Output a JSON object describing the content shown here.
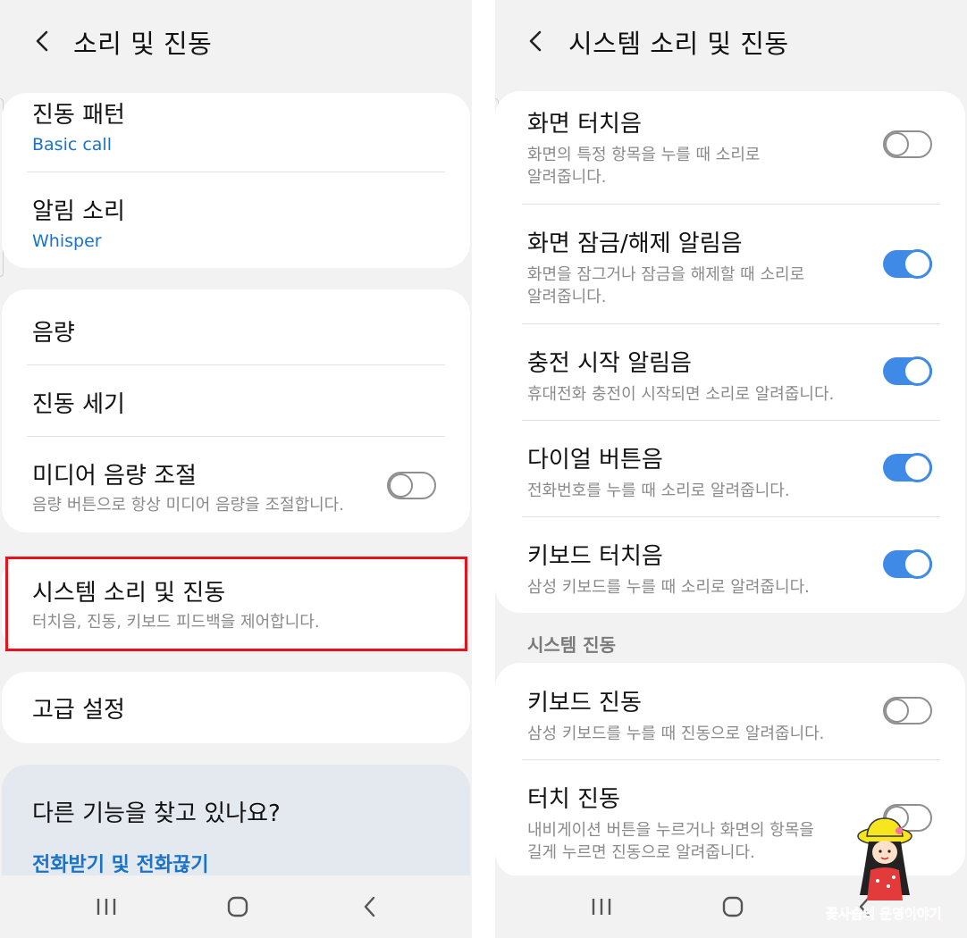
{
  "left": {
    "header": {
      "title": "소리 및 진동"
    },
    "card1": [
      {
        "title": "진동 패턴",
        "value": "Basic call"
      },
      {
        "title": "알림 소리",
        "value": "Whisper"
      }
    ],
    "card2": {
      "volume": "음량",
      "vibration_intensity": "진동 세기",
      "media_volume": {
        "title": "미디어 음량 조절",
        "subtitle": "음량 버튼으로 항상 미디어 음량을 조절합니다.",
        "enabled": false
      }
    },
    "system_sound": {
      "title": "시스템 소리 및 진동",
      "subtitle": "터치음, 진동, 키보드 피드백을 제어합니다."
    },
    "advanced": {
      "title": "고급 설정"
    },
    "search": {
      "question": "다른 기능을 찾고 있나요?",
      "link": "전화받기 및 전화끊기"
    }
  },
  "right": {
    "header": {
      "title": "시스템 소리 및 진동"
    },
    "sound_items": [
      {
        "title": "화면 터치음",
        "subtitle": "화면의 특정 항목을 누를 때 소리로\n알려줍니다.",
        "enabled": false
      },
      {
        "title": "화면 잠금/해제 알림음",
        "subtitle": "화면을 잠그거나 잠금을 해제할 때 소리로\n알려줍니다.",
        "enabled": true
      },
      {
        "title": "충전 시작 알림음",
        "subtitle": "휴대전화 충전이 시작되면 소리로 알려줍니다.",
        "enabled": true
      },
      {
        "title": "다이얼 버튼음",
        "subtitle": "전화번호를 누를 때 소리로 알려줍니다.",
        "enabled": true
      },
      {
        "title": "키보드 터치음",
        "subtitle": "삼성 키보드를 누를 때 소리로 알려줍니다.",
        "enabled": true
      }
    ],
    "section_label": "시스템 진동",
    "vibration_items": [
      {
        "title": "키보드 진동",
        "subtitle": "삼성 키보드를 누를 때 진동으로 알려줍니다.",
        "enabled": false
      },
      {
        "title": "터치 진동",
        "subtitle": "내비게이션 버튼을 누르거나 화면의 항목을\n길게 누르면 진동으로 알려줍니다.",
        "enabled": false
      }
    ]
  },
  "navbar": {
    "icons": [
      "recent-apps-icon",
      "home-icon",
      "back-icon"
    ]
  },
  "watermark": {
    "text": "꽃사슴의 운영이야기"
  },
  "colors": {
    "accent": "#3e8ae6",
    "link": "#1a73c8",
    "highlight": "#e2141d",
    "background": "#f2f2f2"
  }
}
